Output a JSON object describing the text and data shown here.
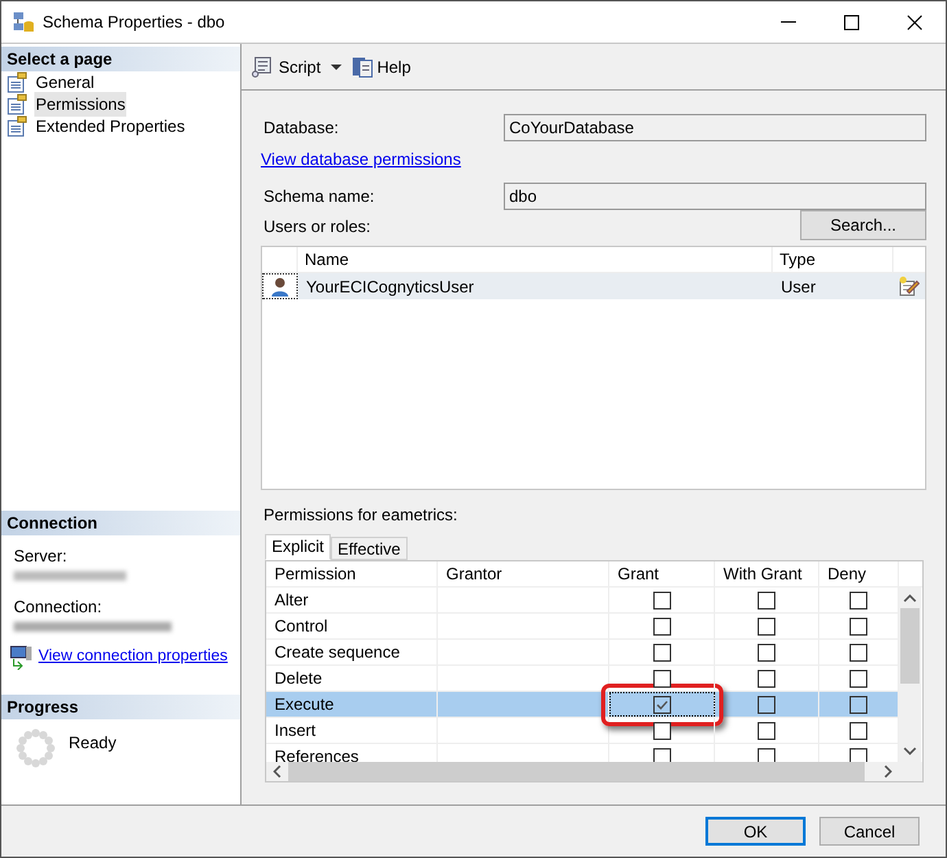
{
  "window": {
    "title": "Schema Properties - dbo"
  },
  "sidebar": {
    "heading": "Select a page",
    "pages": [
      {
        "label": "General",
        "selected": false
      },
      {
        "label": "Permissions",
        "selected": true
      },
      {
        "label": "Extended Properties",
        "selected": false
      }
    ]
  },
  "connection": {
    "heading": "Connection",
    "server_label": "Server:",
    "connection_label": "Connection:",
    "link": "View connection properties"
  },
  "progress": {
    "heading": "Progress",
    "status": "Ready"
  },
  "toolbar": {
    "buttons": [
      {
        "label": "Script",
        "kind": "script"
      },
      {
        "label": "Help",
        "kind": "help"
      }
    ]
  },
  "form": {
    "database_label": "Database:",
    "database_value": "CoYourDatabase",
    "permissions_link": "View database permissions",
    "schema_label": "Schema name:",
    "schema_value": "dbo",
    "users_label": "Users or roles:",
    "search_button": "Search..."
  },
  "users_table": {
    "columns": [
      "Name",
      "Type"
    ],
    "rows": [
      {
        "name": "YourECICognyticsUser",
        "type": "User",
        "selected": true
      }
    ]
  },
  "permissions": {
    "label": "Permissions for eametrics:",
    "tabs": [
      {
        "label": "Explicit",
        "selected": true
      },
      {
        "label": "Effective",
        "selected": false
      }
    ],
    "columns": [
      "Permission",
      "Grantor",
      "Grant",
      "With Grant",
      "Deny"
    ],
    "rows": [
      {
        "permission": "Alter",
        "grant": false,
        "with_grant": false,
        "deny": false,
        "selected": false,
        "highlighted": false
      },
      {
        "permission": "Control",
        "grant": false,
        "with_grant": false,
        "deny": false,
        "selected": false,
        "highlighted": false
      },
      {
        "permission": "Create sequence",
        "grant": false,
        "with_grant": false,
        "deny": false,
        "selected": false,
        "highlighted": false
      },
      {
        "permission": "Delete",
        "grant": false,
        "with_grant": false,
        "deny": false,
        "selected": false,
        "highlighted": false
      },
      {
        "permission": "Execute",
        "grant": true,
        "with_grant": false,
        "deny": false,
        "selected": true,
        "highlighted": true
      },
      {
        "permission": "Insert",
        "grant": false,
        "with_grant": false,
        "deny": false,
        "selected": false,
        "highlighted": false
      },
      {
        "permission": "References",
        "grant": false,
        "with_grant": false,
        "deny": false,
        "selected": false,
        "highlighted": false
      }
    ]
  },
  "buttons": [
    {
      "label": "OK",
      "default": true
    },
    {
      "label": "Cancel",
      "default": false
    }
  ]
}
